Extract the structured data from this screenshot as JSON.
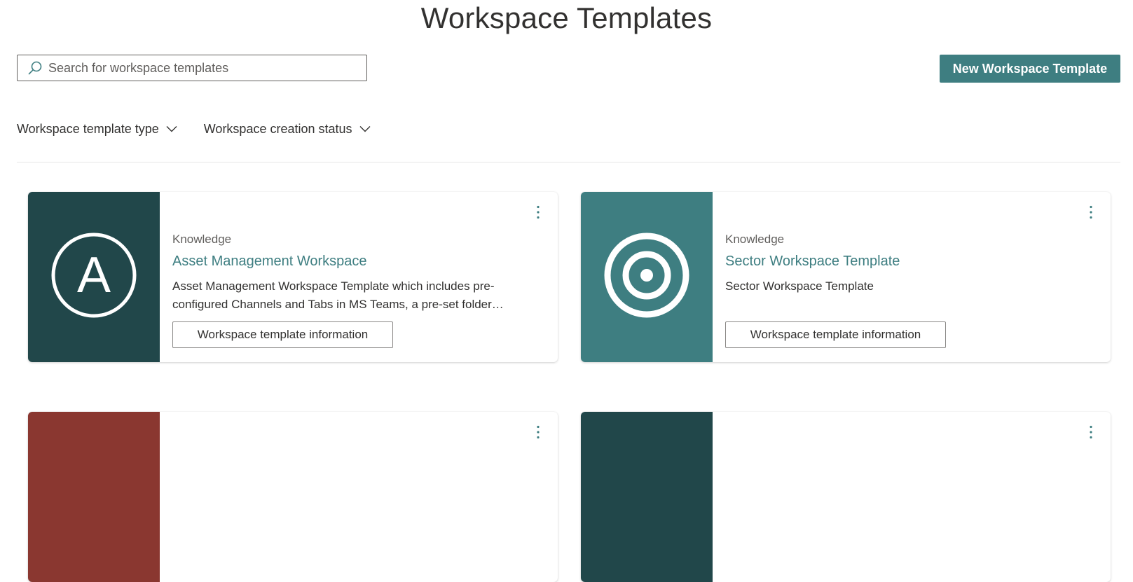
{
  "header": {
    "title": "Workspace Templates",
    "new_button_label": "New Workspace Template"
  },
  "search": {
    "placeholder": "Search for workspace templates",
    "value": ""
  },
  "filters": [
    {
      "label": "Workspace template type"
    },
    {
      "label": "Workspace creation status"
    }
  ],
  "colors": {
    "accent": "#3e7e81",
    "dark_teal": "#21474a",
    "teal": "#3e7e81",
    "rust": "#8a3730"
  },
  "cards": [
    {
      "category": "Knowledge",
      "title": "Asset Management Workspace",
      "description": "Asset Management Workspace Template which includes pre-configured Channels and Tabs in MS Teams, a pre-set folder structure and document libraries.",
      "button_label": "Workspace template information",
      "icon": "letter-a-circle-icon",
      "thumb_color": "#21474a"
    },
    {
      "category": "Knowledge",
      "title": "Sector Workspace Template",
      "description": "Sector Workspace Template",
      "button_label": "Workspace template information",
      "icon": "target-icon",
      "thumb_color": "#3e7e81"
    },
    {
      "icon": "template-icon",
      "thumb_color": "#8a3730"
    },
    {
      "icon": "template-icon",
      "thumb_color": "#21474a"
    }
  ]
}
